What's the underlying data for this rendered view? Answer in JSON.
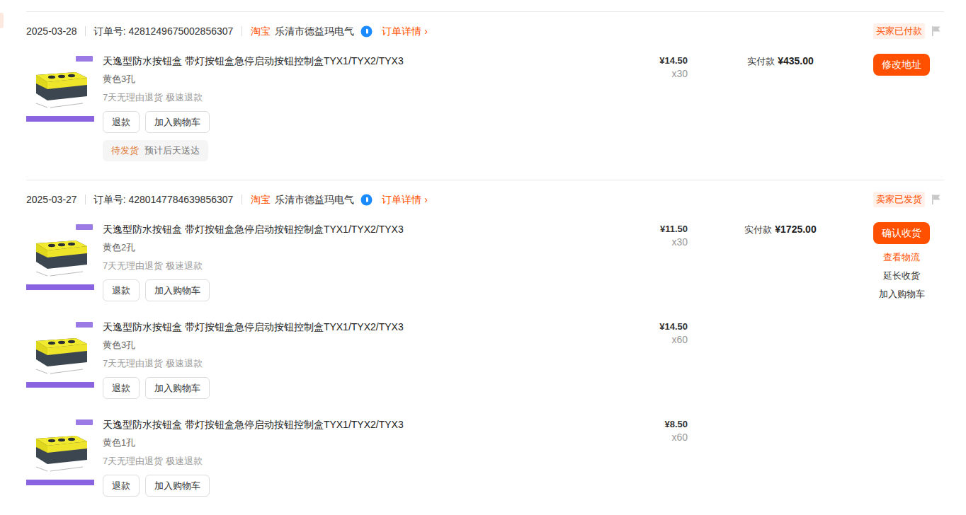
{
  "orders": [
    {
      "date": "2025-03-28",
      "order_no": "订单号: 4281249675002856307",
      "platform": "淘宝",
      "shop": "乐清市德益玛电气",
      "detail_link": "订单详情 ›",
      "status": "买家已付款",
      "total_label": "实付款",
      "total": "¥435.00",
      "actions": [
        {
          "label": "修改地址",
          "kind": "primary"
        }
      ],
      "items": [
        {
          "title": "天逸型防水按钮盒 带灯按钮盒急停启动按钮控制盒TYX1/TYX2/TYX3",
          "variant": "黄色3孔",
          "tags": "7天无理由退货 极速退款",
          "buttons": [
            "退款",
            "加入购物车"
          ],
          "price": "¥14.50",
          "qty": "x30",
          "shipping": {
            "status": "待发货",
            "eta": "预计后天送达"
          }
        }
      ]
    },
    {
      "date": "2025-03-27",
      "order_no": "订单号: 4280147784639856307",
      "platform": "淘宝",
      "shop": "乐清市德益玛电气",
      "detail_link": "订单详情 ›",
      "status": "卖家已发货",
      "total_label": "实付款",
      "total": "¥1725.00",
      "actions": [
        {
          "label": "确认收货",
          "kind": "primary"
        },
        {
          "label": "查看物流",
          "kind": "link"
        },
        {
          "label": "延长收货",
          "kind": "text"
        },
        {
          "label": "加入购物车",
          "kind": "text"
        }
      ],
      "items": [
        {
          "title": "天逸型防水按钮盒 带灯按钮盒急停启动按钮控制盒TYX1/TYX2/TYX3",
          "variant": "黄色2孔",
          "tags": "7天无理由退货 极速退款",
          "buttons": [
            "退款",
            "加入购物车"
          ],
          "price": "¥11.50",
          "qty": "x30"
        },
        {
          "title": "天逸型防水按钮盒 带灯按钮盒急停启动按钮控制盒TYX1/TYX2/TYX3",
          "variant": "黄色3孔",
          "tags": "7天无理由退货 极速退款",
          "buttons": [
            "退款",
            "加入购物车"
          ],
          "price": "¥14.50",
          "qty": "x60"
        },
        {
          "title": "天逸型防水按钮盒 带灯按钮盒急停启动按钮控制盒TYX1/TYX2/TYX3",
          "variant": "黄色1孔",
          "tags": "7天无理由退货 极速退款",
          "buttons": [
            "退款",
            "加入购物车"
          ],
          "price": "¥8.50",
          "qty": "x60"
        }
      ]
    }
  ]
}
